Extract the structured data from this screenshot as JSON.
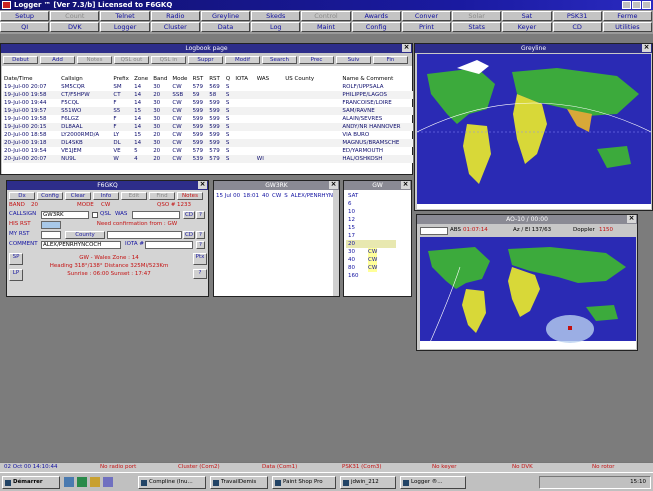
{
  "titlebar": {
    "text": "Logger ™ [Ver 7.3/b] Licensed to F6GKQ"
  },
  "toolbar": {
    "row1": [
      {
        "label": "Setup",
        "enabled": true
      },
      {
        "label": "Count",
        "enabled": false
      },
      {
        "label": "Telnet",
        "enabled": true
      },
      {
        "label": "Radio",
        "enabled": true
      },
      {
        "label": "Greyline",
        "enabled": true
      },
      {
        "label": "Skeds",
        "enabled": true
      },
      {
        "label": "Control",
        "enabled": false
      },
      {
        "label": "Awards",
        "enabled": true
      },
      {
        "label": "Conver",
        "enabled": true
      },
      {
        "label": "Solar",
        "enabled": false
      },
      {
        "label": "Sat",
        "enabled": true
      },
      {
        "label": "PSK31",
        "enabled": true
      },
      {
        "label": "Ferme",
        "enabled": true
      }
    ],
    "row2": [
      {
        "label": "QI",
        "enabled": true
      },
      {
        "label": "DVK",
        "enabled": true
      },
      {
        "label": "Logger",
        "enabled": true
      },
      {
        "label": "Cluster",
        "enabled": true
      },
      {
        "label": "Data",
        "enabled": true
      },
      {
        "label": "Log",
        "enabled": true
      },
      {
        "label": "Maint",
        "enabled": true
      },
      {
        "label": "Config",
        "enabled": true
      },
      {
        "label": "Print",
        "enabled": true
      },
      {
        "label": "Stats",
        "enabled": true
      },
      {
        "label": "Keyer",
        "enabled": true
      },
      {
        "label": "CD",
        "enabled": true
      },
      {
        "label": "Utilities",
        "enabled": true
      }
    ]
  },
  "logbook": {
    "title": "Logbook page",
    "buttons": [
      "Debut",
      "Add",
      "Notes",
      "QSL out",
      "QSL in",
      "Suppr",
      "Modif",
      "Search",
      "Prec",
      "Suiv",
      "Fin"
    ],
    "columns": [
      "Date/Time",
      "Callsign",
      "Prefix",
      "Zone",
      "Band",
      "Mode",
      "RST",
      "RST",
      "Q",
      "IOTA",
      "WAS",
      "US County",
      "Name & Comment"
    ],
    "rows": [
      [
        "19-Jul-00 20:07",
        "SM5CQR",
        "SM",
        "14",
        "30",
        "CW",
        "579",
        "569",
        "S",
        "",
        "",
        "",
        "ROLF/UPPSALA"
      ],
      [
        "19-Jul-00 19:58",
        "CT/F5HPW",
        "CT",
        "14",
        "20",
        "SSB",
        "59",
        "58",
        "S",
        "",
        "",
        "",
        "PHILIPPE/LAGOS"
      ],
      [
        "19-Jul-00 19:44",
        "F5CQL",
        "F",
        "14",
        "30",
        "CW",
        "599",
        "599",
        "S",
        "",
        "",
        "",
        "FRANCOISE/LOIRE"
      ],
      [
        "19-Jul-00 19:57",
        "S51WO",
        "S5",
        "15",
        "30",
        "CW",
        "599",
        "599",
        "S",
        "",
        "",
        "",
        "SAM/RAVNE"
      ],
      [
        "19-Jul-00 19:58",
        "F6LGZ",
        "F",
        "14",
        "30",
        "CW",
        "599",
        "599",
        "S",
        "",
        "",
        "",
        "ALAIN/SEVRES"
      ],
      [
        "19-Jul-00 20:15",
        "DL8AAL",
        "F",
        "14",
        "30",
        "CW",
        "599",
        "599",
        "S",
        "",
        "",
        "",
        "ANDY/NR HANNOVER"
      ],
      [
        "20-Jul-00 18:58",
        "LY2000RMD/A",
        "LY",
        "15",
        "20",
        "CW",
        "599",
        "599",
        "S",
        "",
        "",
        "",
        "VIA BURO"
      ],
      [
        "20-Jul-00 19:18",
        "DL4SKB",
        "DL",
        "14",
        "30",
        "CW",
        "599",
        "599",
        "S",
        "",
        "",
        "",
        "MAGNUS/BRAMSCHE"
      ],
      [
        "20-Jul-00 19:54",
        "VE1JEM",
        "VE",
        "5",
        "20",
        "CW",
        "579",
        "579",
        "S",
        "",
        "",
        "",
        "ED/YARMOUTH"
      ],
      [
        "20-Jul-00 20:07",
        "NU9L",
        "W",
        "4",
        "20",
        "CW",
        "539",
        "579",
        "S",
        "",
        "WI",
        "",
        "HAL/OSHKOSH"
      ]
    ]
  },
  "graylinemap": {
    "title": "Greyline"
  },
  "qso": {
    "title": "F6GKQ",
    "buttons": [
      "Dx",
      "Config",
      "Clear",
      "Info",
      "Edit",
      "Find",
      "Notes"
    ],
    "band_label": "BAND",
    "band_value": "20",
    "mode_label": "MODE",
    "mode_value": "CW",
    "qso_label": "QSO #",
    "qso_value": "1233",
    "call_label": "CALLSIGN",
    "call_value": "GW3RK",
    "qsl_label": "QSL",
    "was_label": "WAS",
    "his_rst_label": "HIS RST",
    "his_rst_value": "",
    "need_text": "Need confirmation from : GW",
    "my_rst_label": "MY RST",
    "county_label": "County",
    "comment_label": "COMMENT",
    "comment_value": "ALEX/PENRHYNCOCH",
    "iota_label": "IOTA #",
    "info_line1": "GW - Wales   Zone : 14",
    "info_line2": "Heading 318°/138°  Distance 325Mi/523Km",
    "info_line3": "Sunrise : 06:00   Sunset : 17:47",
    "side_buttons": [
      "SP",
      "LP",
      "Ptx"
    ]
  },
  "gwpanel": {
    "title": "GW3RK",
    "row": [
      "15 Jul 00",
      "18:01",
      "40",
      "CW",
      "S",
      "ALEX/PENRHYNCOCH"
    ]
  },
  "bandpanel": {
    "title": "GW",
    "bands": [
      {
        "b": "SAT",
        "m": ""
      },
      {
        "b": "6",
        "m": ""
      },
      {
        "b": "10",
        "m": ""
      },
      {
        "b": "12",
        "m": ""
      },
      {
        "b": "15",
        "m": ""
      },
      {
        "b": "17",
        "m": ""
      },
      {
        "b": "20",
        "m": ""
      },
      {
        "b": "30",
        "m": "CW"
      },
      {
        "b": "40",
        "m": "CW"
      },
      {
        "b": "80",
        "m": "CW"
      },
      {
        "b": "160",
        "m": ""
      }
    ]
  },
  "satmap": {
    "title": "AO-10 / 00:00",
    "abs_label": "ABS",
    "abs_value": "01:07:14",
    "azel": "Az / El 137/63",
    "doppler_label": "Doppler",
    "doppler_value": "1150"
  },
  "status": {
    "datetime": "02 Oct 00 14:10:44",
    "items": [
      "No radio port",
      "Cluster (Com2)",
      "Data (Com1)",
      "PSK31 (Com3)",
      "No keyer",
      "No DVK",
      "No rotor"
    ]
  },
  "taskbar": {
    "start": "Démarrer",
    "tasks": [
      "Compline (Inu...",
      "TravailDemis",
      "Paint Shop Pro",
      "jdwin_212",
      "Logger ®..."
    ],
    "clock": "15:10"
  },
  "colors": {
    "title": "#2d2d8a",
    "accent_red": "#c41010",
    "link_blue": "#1010a0",
    "ocean": "#2222b0",
    "land_green": "#3caa3c",
    "land_yellow": "#d8d838"
  }
}
